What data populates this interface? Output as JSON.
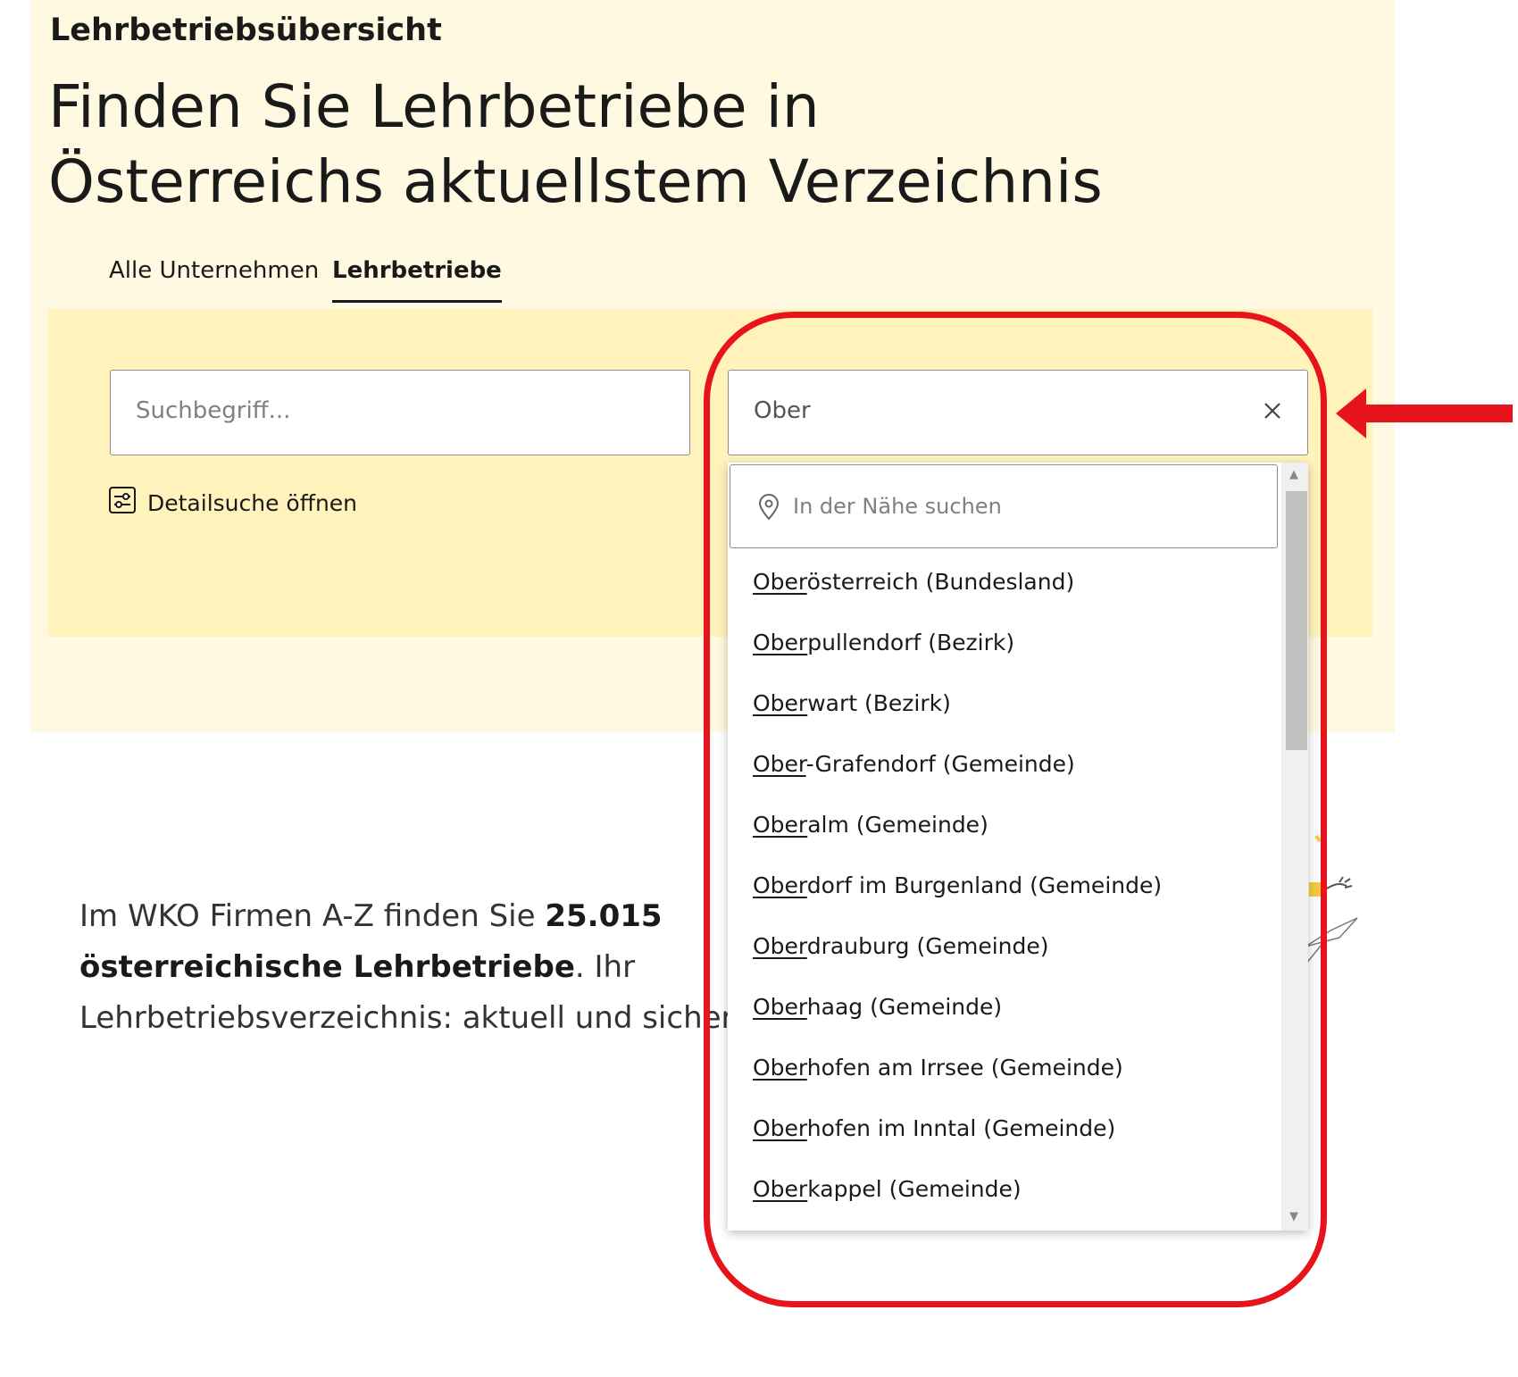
{
  "hero": {
    "kicker": "Lehrbetriebsübersicht",
    "headline": "Finden Sie Lehrbetriebe in Österreichs aktuellstem Verzeichnis"
  },
  "tabs": [
    {
      "label": "Alle Unternehmen",
      "active": false
    },
    {
      "label": "Lehrbetriebe",
      "active": true
    }
  ],
  "search": {
    "placeholder": "Suchbegriff...",
    "location_value": "Ober",
    "detail_link": "Detailsuche öffnen"
  },
  "dropdown": {
    "near_label": "In der Nähe suchen",
    "match": "Ober",
    "items": [
      {
        "match": "Ober",
        "rest": "österreich (Bundesland)"
      },
      {
        "match": "Ober",
        "rest": "pullendorf (Bezirk)"
      },
      {
        "match": "Ober",
        "rest": "wart (Bezirk)"
      },
      {
        "match": "Ober",
        "rest": "-Grafendorf (Gemeinde)"
      },
      {
        "match": "Ober",
        "rest": "alm (Gemeinde)"
      },
      {
        "match": "Ober",
        "rest": "dorf im Burgenland (Gemeinde)"
      },
      {
        "match": "Ober",
        "rest": "drauburg (Gemeinde)"
      },
      {
        "match": "Ober",
        "rest": "haag (Gemeinde)"
      },
      {
        "match": "Ober",
        "rest": "hofen am Irrsee (Gemeinde)"
      },
      {
        "match": "Ober",
        "rest": "hofen im Inntal (Gemeinde)"
      },
      {
        "match": "Ober",
        "rest": "kappel (Gemeinde)"
      }
    ]
  },
  "intro": {
    "part1": "Im WKO Firmen A-Z finden Sie ",
    "bold": "25.015 österreichische Lehrbetriebe",
    "part2": ". Ihr Lehrbetriebsverzeichnis: aktuell und sicher"
  },
  "colors": {
    "hero_bg": "#fff9e1",
    "panel_bg": "#fff3bb",
    "annotation_red": "#e8141c"
  },
  "icons": {
    "clear": "close-icon",
    "detail": "filter-sliders-icon",
    "location": "map-pin-icon"
  }
}
